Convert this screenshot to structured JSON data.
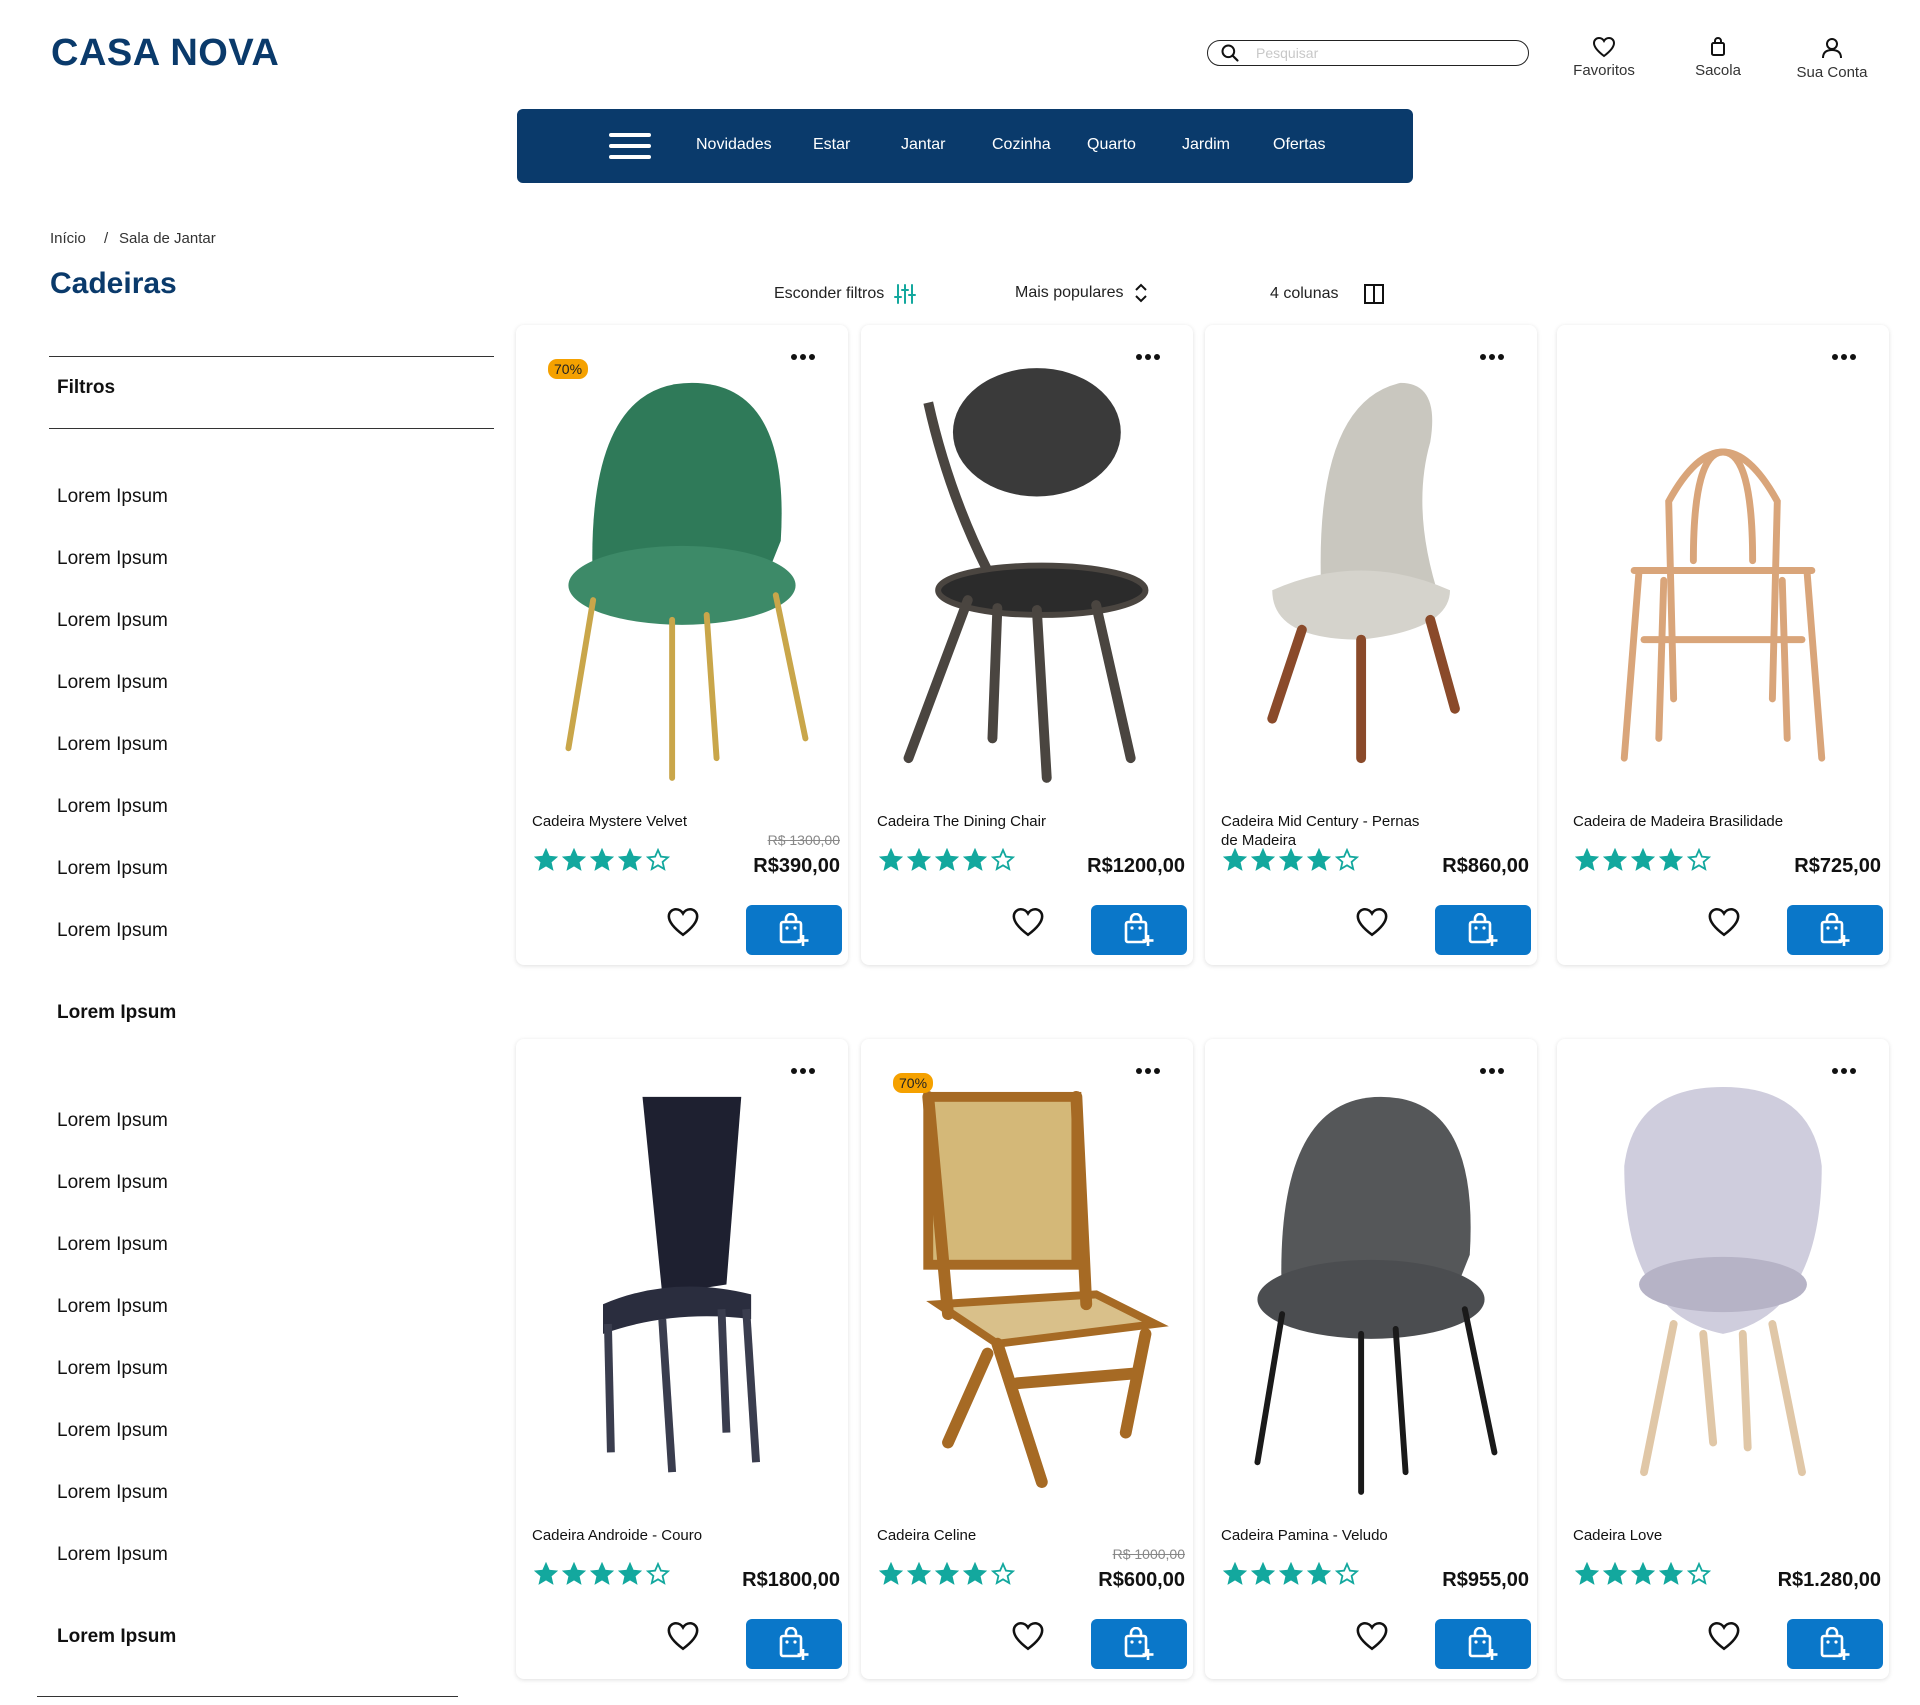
{
  "header": {
    "logo": "CASA NOVA",
    "search_placeholder": "Pesquisar",
    "actions": [
      {
        "label": "Favoritos",
        "icon": "heart-icon"
      },
      {
        "label": "Sacola",
        "icon": "bag-icon"
      },
      {
        "label": "Sua Conta",
        "icon": "user-icon"
      }
    ]
  },
  "nav": {
    "items": [
      "Novidades",
      "Estar",
      "Jantar",
      "Cozinha",
      "Quarto",
      "Jardim",
      "Ofertas"
    ]
  },
  "breadcrumb": {
    "home": "Início",
    "separator": "/",
    "current": "Sala de Jantar"
  },
  "page_title": "Cadeiras",
  "filters": {
    "heading": "Filtros",
    "group1": [
      "Lorem Ipsum",
      "Lorem Ipsum",
      "Lorem Ipsum",
      "Lorem Ipsum",
      "Lorem Ipsum",
      "Lorem Ipsum",
      "Lorem Ipsum",
      "Lorem Ipsum"
    ],
    "group1_bold": "Lorem Ipsum",
    "group2": [
      "Lorem Ipsum",
      "Lorem Ipsum",
      "Lorem Ipsum",
      "Lorem Ipsum",
      "Lorem Ipsum",
      "Lorem Ipsum",
      "Lorem Ipsum",
      "Lorem Ipsum"
    ],
    "group2_bold": "Lorem Ipsum"
  },
  "toolbar": {
    "hide_filters": "Esconder filtros",
    "sort": "Mais populares",
    "columns": "4 colunas"
  },
  "colors": {
    "brand": "#0a3a6b",
    "cart_button": "#0a77c9",
    "stars": "#13a89e",
    "badge": "#f5a100"
  },
  "products": [
    {
      "name": "Cadeira Mystere Velvet",
      "old_price": "R$ 1300,00",
      "price": "R$390,00",
      "badge": "70%",
      "rating": 4,
      "image": "green-velvet-chair"
    },
    {
      "name": "Cadeira The Dining Chair",
      "old_price": "",
      "price": "R$1200,00",
      "badge": "",
      "rating": 4,
      "image": "black-leather-wood-chair"
    },
    {
      "name": "Cadeira Mid Century - Pernas de Madeira",
      "old_price": "",
      "price": "R$860,00",
      "badge": "",
      "rating": 4,
      "image": "beige-upholstered-chair"
    },
    {
      "name": "Cadeira de Madeira Brasilidade",
      "old_price": "",
      "price": "R$725,00",
      "badge": "",
      "rating": 4,
      "image": "bentwood-chair"
    },
    {
      "name": "Cadeira Androide - Couro",
      "old_price": "",
      "price": "R$1800,00",
      "badge": "",
      "rating": 4,
      "image": "navy-leather-chair"
    },
    {
      "name": "Cadeira Celine",
      "old_price": "R$ 1000,00",
      "price": "R$600,00",
      "badge": "70%",
      "rating": 4,
      "image": "cane-wood-chair"
    },
    {
      "name": "Cadeira Pamina - Veludo",
      "old_price": "",
      "price": "R$955,00",
      "badge": "",
      "rating": 4,
      "image": "grey-velvet-chair"
    },
    {
      "name": "Cadeira Love",
      "old_price": "",
      "price": "R$1.280,00",
      "badge": "",
      "rating": 4,
      "image": "lilac-quilted-chair"
    }
  ]
}
